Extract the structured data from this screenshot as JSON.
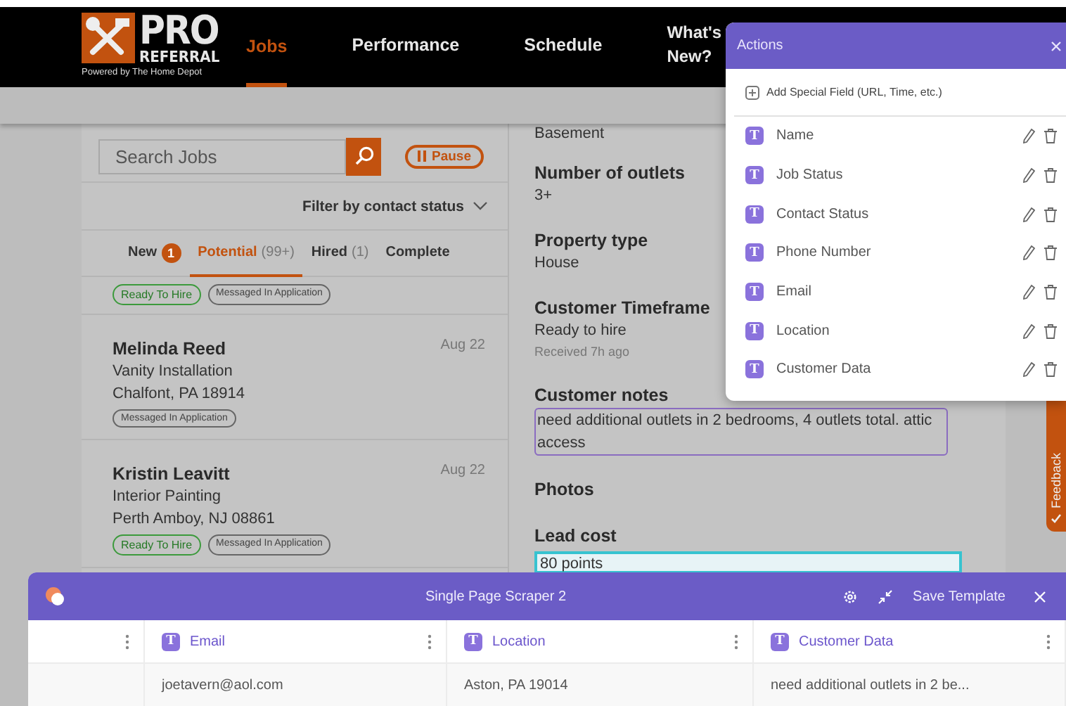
{
  "nav": {
    "logo_title": "PRO",
    "logo_subtitle": "REFERRAL",
    "logo_tagline": "Powered by The Home Depot",
    "items": [
      {
        "label": "Jobs",
        "selected": true
      },
      {
        "label": "Performance",
        "selected": false
      },
      {
        "label": "Schedule",
        "selected": false
      },
      {
        "label": "What's New?",
        "selected": false
      }
    ]
  },
  "job_list": {
    "search": {
      "placeholder": "Search Jobs"
    },
    "pause_button": "Pause",
    "filter": "Filter by contact status",
    "tabs": [
      {
        "label": "New",
        "badge": "1",
        "selected": false
      },
      {
        "label": "Potential",
        "count": "(99+)",
        "selected": true
      },
      {
        "label": "Hired",
        "count": "(1)",
        "selected": false
      },
      {
        "label": "Complete",
        "selected": false
      }
    ],
    "jobs": [
      {
        "tags": [
          {
            "label": "Ready To Hire",
            "kind": "ready"
          },
          {
            "label": "Messaged In Application",
            "kind": "messaged"
          }
        ]
      },
      {
        "name": "Melinda Reed",
        "date": "Aug 22",
        "service": "Vanity Installation",
        "address": "Chalfont, PA 18914",
        "tags": [
          {
            "label": "Messaged In Application",
            "kind": "messaged"
          }
        ]
      },
      {
        "name": "Kristin Leavitt",
        "date": "Aug 22",
        "service": "Interior Painting",
        "address": "Perth Amboy, NJ 08861",
        "tags": [
          {
            "label": "Ready To Hire",
            "kind": "ready"
          },
          {
            "label": "Messaged In Application",
            "kind": "messaged"
          }
        ]
      }
    ]
  },
  "detail": {
    "fields": [
      {
        "kind": "value",
        "text": "Basement"
      },
      {
        "kind": "heading",
        "text": "Number of outlets"
      },
      {
        "kind": "value",
        "text": "3+"
      },
      {
        "kind": "heading",
        "text": "Property type"
      },
      {
        "kind": "value",
        "text": "House"
      },
      {
        "kind": "heading",
        "text": "Customer Timeframe"
      },
      {
        "kind": "value",
        "text": "Ready to hire"
      },
      {
        "kind": "note",
        "text": "Received 7h ago"
      },
      {
        "kind": "heading",
        "text": "Customer notes"
      },
      {
        "kind": "selected",
        "text": "need additional outlets in 2 bedrooms, 4 outlets total. attic access"
      },
      {
        "kind": "heading",
        "text": "Photos"
      },
      {
        "kind": "heading",
        "text": "Lead cost"
      },
      {
        "kind": "input",
        "text": "80 points"
      }
    ]
  },
  "feedback": {
    "label": "Feedback"
  },
  "actions_panel": {
    "title": "Actions",
    "add_field": "Add Special Field (URL, Time, etc.)",
    "fields": [
      {
        "type_badge": "T",
        "label": "Name"
      },
      {
        "type_badge": "T",
        "label": "Job Status"
      },
      {
        "type_badge": "T",
        "label": "Contact Status"
      },
      {
        "type_badge": "T",
        "label": "Phone Number"
      },
      {
        "type_badge": "T",
        "label": "Email"
      },
      {
        "type_badge": "T",
        "label": "Location"
      },
      {
        "type_badge": "T",
        "label": "Customer Data"
      }
    ]
  },
  "scraper": {
    "title": "Single Page Scraper 2",
    "save_button": "Save Template",
    "columns": [
      {
        "type_badge": "T",
        "label": "Email"
      },
      {
        "type_badge": "T",
        "label": "Location"
      },
      {
        "type_badge": "T",
        "label": "Customer Data"
      }
    ],
    "rows": [
      [
        "joetavern@aol.com",
        "Aston, PA 19014",
        "need additional outlets in 2 be..."
      ]
    ]
  }
}
